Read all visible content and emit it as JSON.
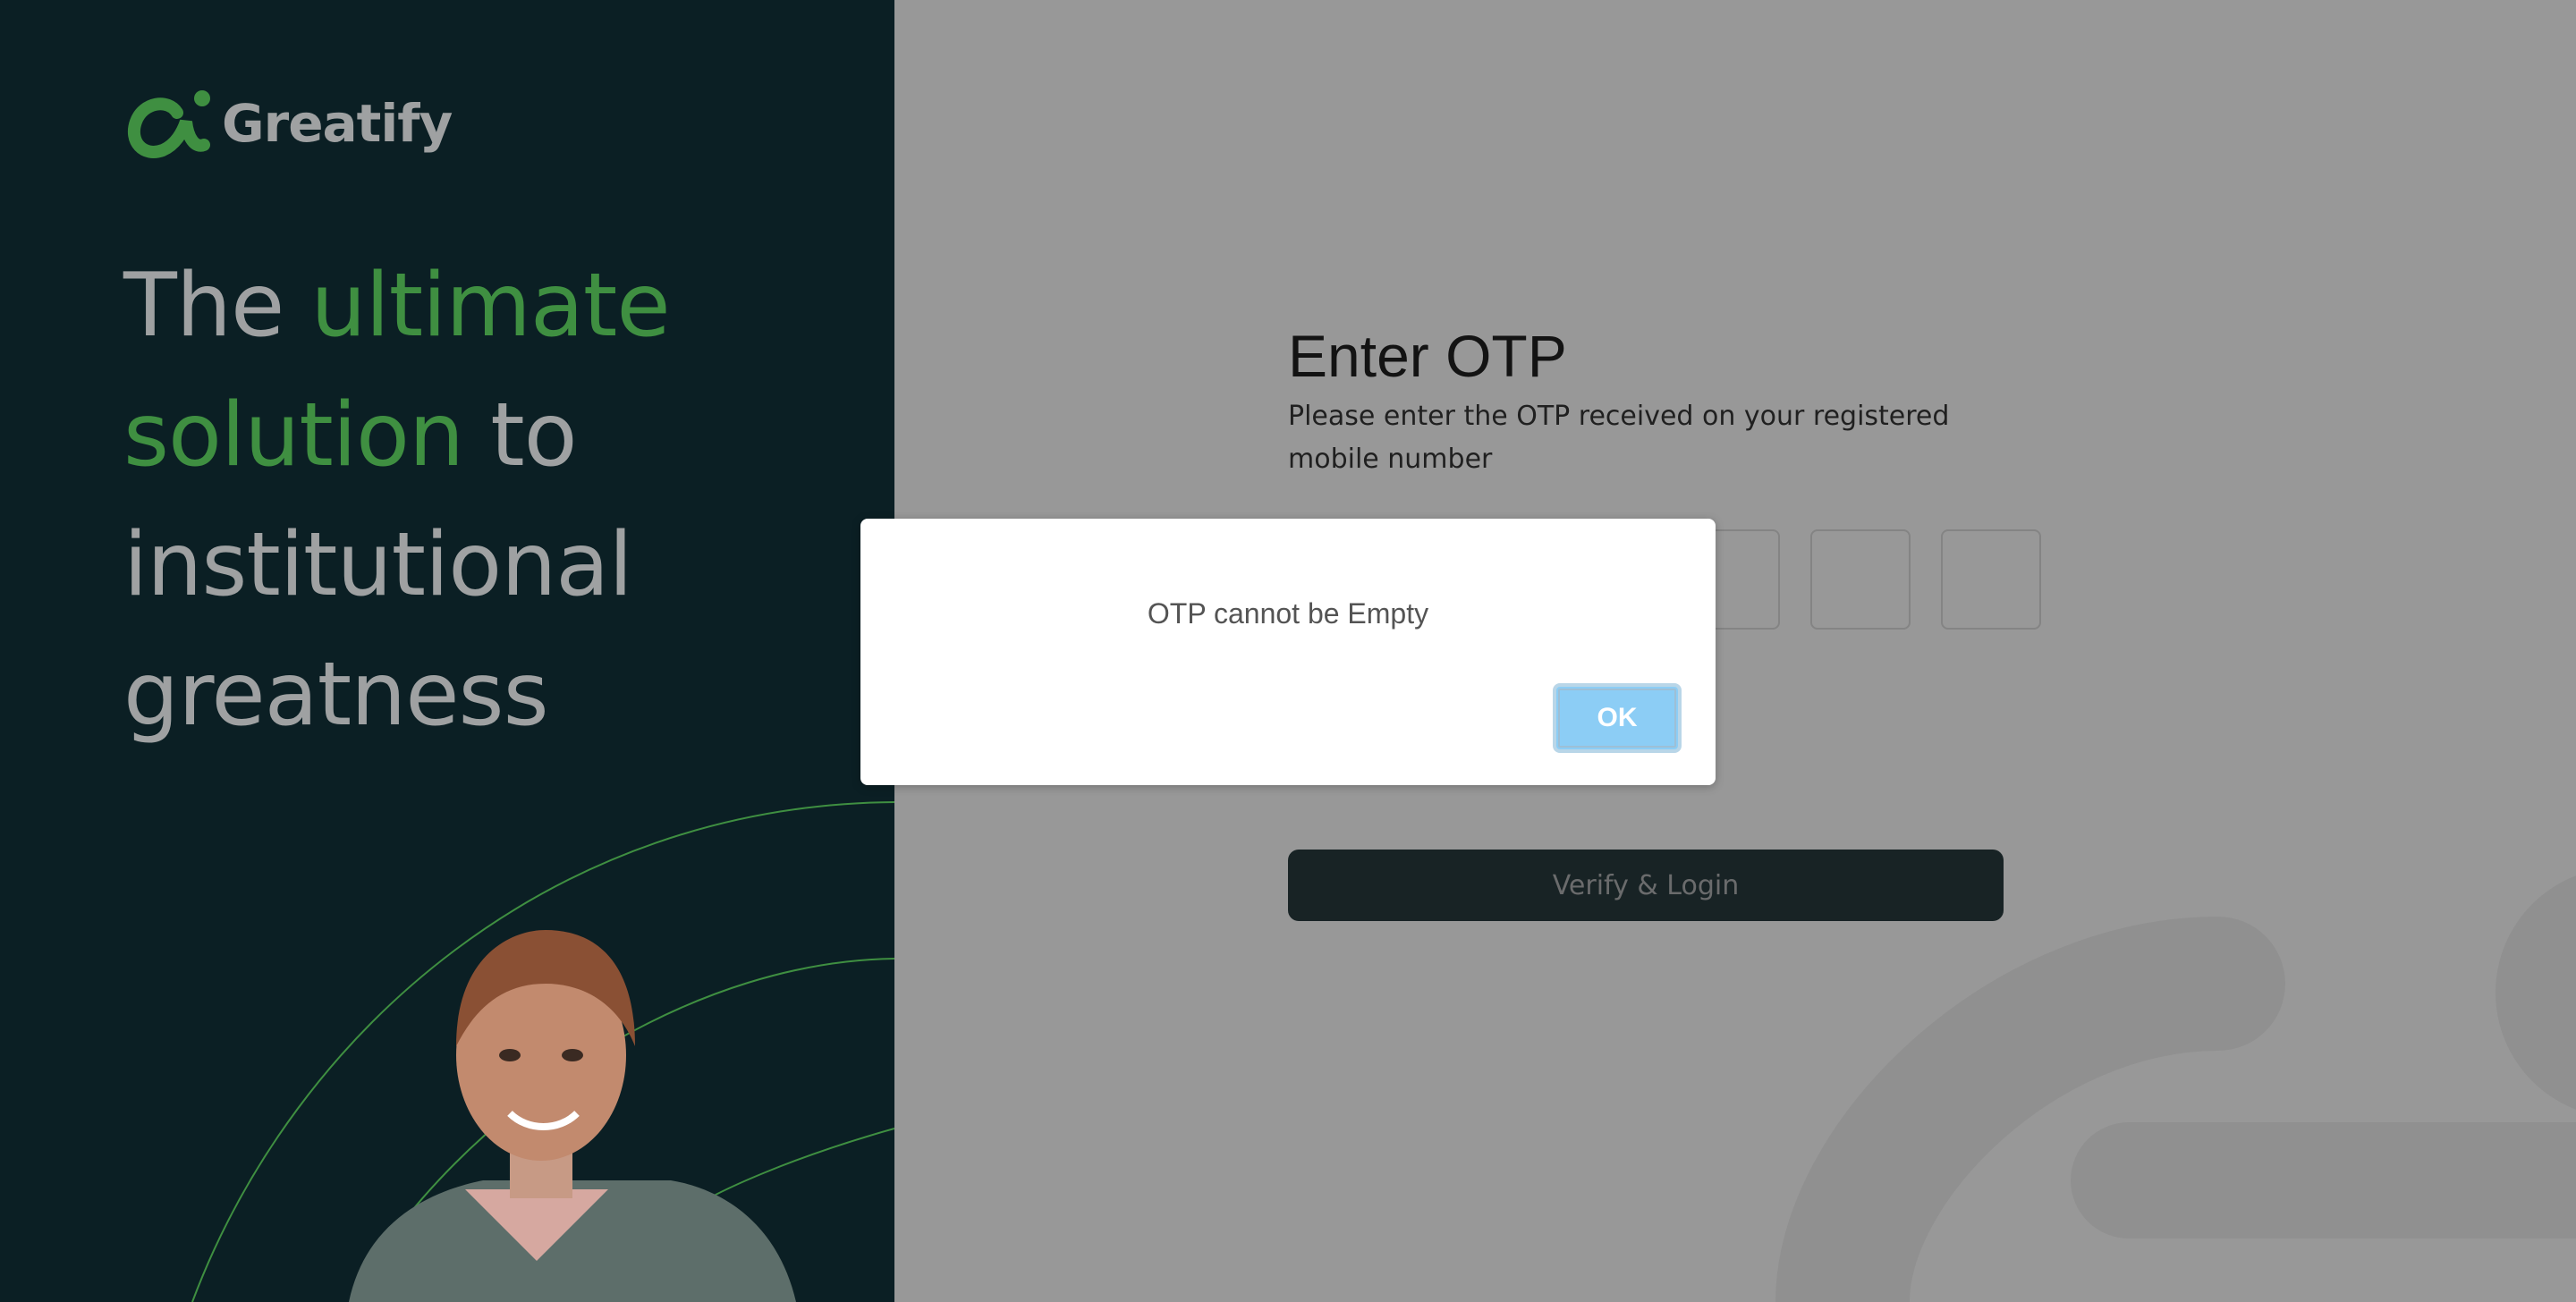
{
  "brand": {
    "name": "Greatify",
    "accent_color": "#3f8f41",
    "dark_bg_color": "#0b1f24"
  },
  "hero": {
    "word1": "The ",
    "word2": "ultimate",
    "word3": "solution",
    "word4": " to",
    "word5": "institutional",
    "word6": "greatness"
  },
  "otp_form": {
    "title": "Enter OTP",
    "description": "Please enter the OTP received on your registered mobile number",
    "box_count": 6,
    "boxes": [
      "",
      "",
      "",
      "",
      "",
      ""
    ],
    "verify_label": "Verify & Login"
  },
  "dialog": {
    "message": "OTP cannot be Empty",
    "ok_label": "OK",
    "ok_color": "#8ccdf5"
  }
}
